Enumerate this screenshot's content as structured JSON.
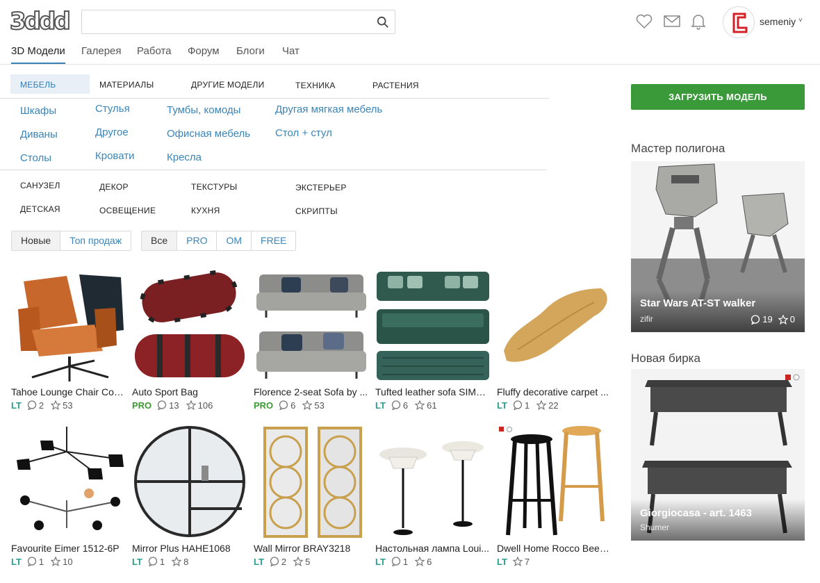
{
  "logo": "3ddd",
  "search": {
    "value": "",
    "placeholder": ""
  },
  "user": {
    "name": "semeniy",
    "caret": "˅"
  },
  "mainnav": [
    "3D Модели",
    "Галерея",
    "Работа",
    "Форум",
    "Блоги",
    "Чат"
  ],
  "categories_top": [
    "МЕБЕЛЬ",
    "МАТЕРИАЛЫ",
    "ДРУГИЕ МОДЕЛИ",
    "ТЕХНИКА",
    "РАСТЕНИЯ"
  ],
  "subcategories": [
    [
      "Шкафы",
      "Диваны",
      "Столы"
    ],
    [
      "Стулья",
      "Другое",
      "Кровати"
    ],
    [
      "Тумбы, комоды",
      "Офисная мебель",
      "Кресла"
    ],
    [
      "Другая мягкая мебель",
      "Стол + стул"
    ]
  ],
  "categories_bottom": [
    [
      "САНУЗЕЛ",
      "ДЕТСКАЯ"
    ],
    [
      "ДЕКОР",
      "ОСВЕЩЕНИЕ"
    ],
    [
      "ТЕКСТУРЫ",
      "КУХНЯ"
    ],
    [
      "ЭКСТЕРЬЕР",
      "СКРИПТЫ"
    ]
  ],
  "filters": {
    "sort": [
      "Новые",
      "Топ продаж"
    ],
    "license": [
      "Все",
      "PRO",
      "OM",
      "FREE"
    ]
  },
  "products": [
    {
      "title": "Tahoe Lounge Chair Cog...",
      "license": "LT",
      "comments": "2",
      "stars": "53"
    },
    {
      "title": "Auto Sport Bag",
      "license": "PRO",
      "comments": "13",
      "stars": "106"
    },
    {
      "title": "Florence 2-seat Sofa by ...",
      "license": "PRO",
      "comments": "6",
      "stars": "53"
    },
    {
      "title": "Tufted leather sofa SIMO...",
      "license": "LT",
      "comments": "6",
      "stars": "61"
    },
    {
      "title": "Fluffy decorative carpet ...",
      "license": "LT",
      "comments": "1",
      "stars": "22"
    },
    {
      "title": "Favourite Eimer 1512-6P",
      "license": "LT",
      "comments": "1",
      "stars": "10"
    },
    {
      "title": "Mirror Plus HAHE1068",
      "license": "LT",
      "comments": "1",
      "stars": "8"
    },
    {
      "title": "Wall Mirror BRAY3218",
      "license": "LT",
      "comments": "2",
      "stars": "5"
    },
    {
      "title": "Настольная лампа Loui...",
      "license": "LT",
      "comments": "1",
      "stars": "6"
    },
    {
      "title": "Dwell Home Rocco Beec...",
      "license": "LT",
      "comments": "",
      "stars": "7"
    }
  ],
  "sidebar": {
    "upload_label": "ЗАГРУЗИТЬ МОДЕЛЬ",
    "section1_title": "Мастер полигона",
    "card1": {
      "name": "Star Wars AT-ST walker",
      "author": "zifir",
      "comments": "19",
      "stars": "0"
    },
    "section2_title": "Новая бирка",
    "card2": {
      "name": "Giorgiocasa - art. 1463",
      "author": "Shumer"
    }
  },
  "colors": {
    "accent": "#3a85b8",
    "upload": "#3a9a3a",
    "lt": "#2a9d8f",
    "pro": "#3b9a2f"
  }
}
